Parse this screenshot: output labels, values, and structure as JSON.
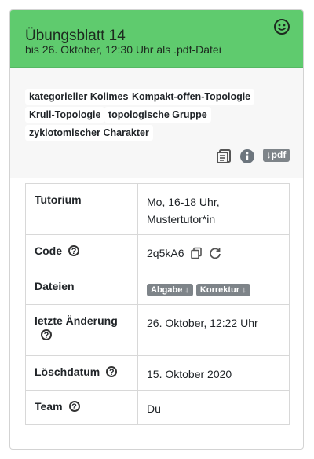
{
  "header": {
    "title": "Übungsblatt 14",
    "subtitle": "bis 26. Oktober, 12:30 Uhr als .pdf-Datei",
    "status_icon": "smiley-icon",
    "color": "#5fcb6e"
  },
  "tags": [
    "kategorieller Kolimes",
    "Kompakt-offen-Topologie",
    "Krull-Topologie",
    "topologische Gruppe",
    "zyklotomischer Charakter"
  ],
  "toolbar": {
    "icons": [
      "list-icon",
      "info-icon"
    ],
    "pdf_label": "↓pdf"
  },
  "table": {
    "tutorium": {
      "label": "Tutorium",
      "value": "Mo, 16-18 Uhr, Mustertutor*in"
    },
    "code": {
      "label": "Code",
      "value": "2q5kA6",
      "help": "?"
    },
    "dateien": {
      "label": "Dateien",
      "abgabe": "Abgabe ↓",
      "korrektur": "Korrektur ↓"
    },
    "letzte": {
      "label": "letzte Änderung",
      "value": "26. Oktober, 12:22 Uhr",
      "help": "?"
    },
    "loesch": {
      "label": "Löschdatum",
      "value": "15. Oktober 2020",
      "help": "?"
    },
    "team": {
      "label": "Team",
      "value": "Du",
      "help": "?"
    }
  }
}
